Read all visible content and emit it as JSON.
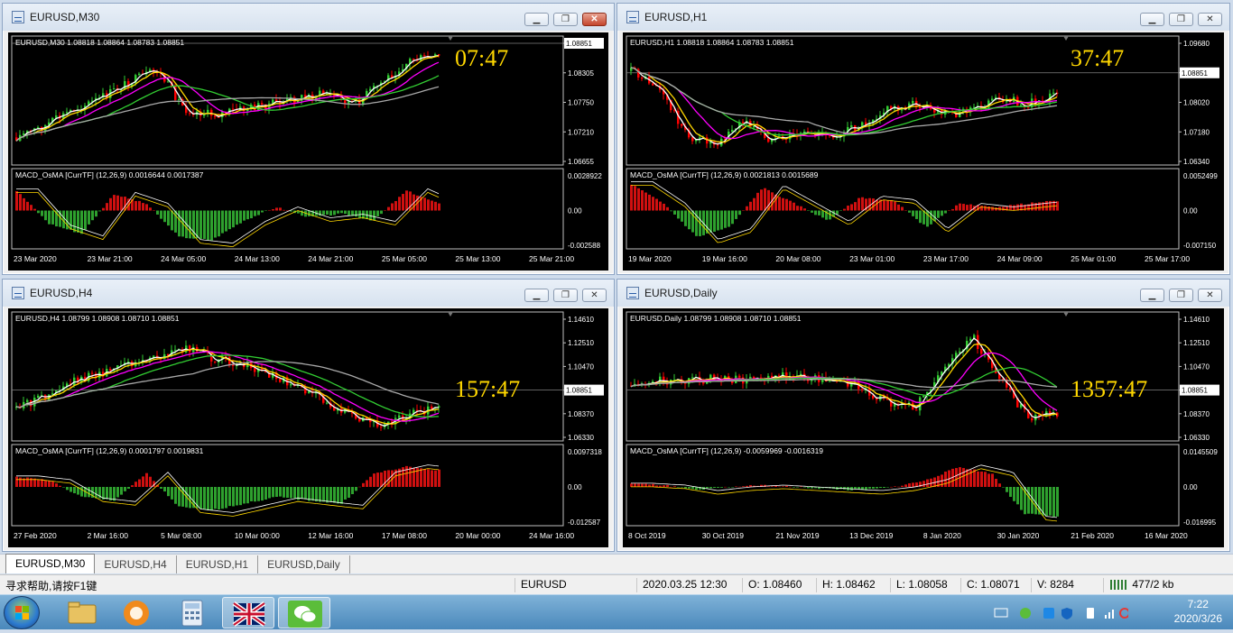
{
  "windows": [
    {
      "title": "EURUSD,M30",
      "info": "EURUSD,M30  1.08818 1.08864 1.08783 1.08851",
      "price_ticks": [
        "1.08851",
        "1.08305",
        "1.07750",
        "1.07210",
        "1.06655"
      ],
      "price_tag": "1.08851",
      "macd_label": "MACD_OsMA [CurrTF] (12,26,9) 0.0016644 0.0017387",
      "macd_ticks": [
        "0.0028922",
        "0.00",
        "-0.002588"
      ],
      "time_labels": [
        "23 Mar 2020",
        "23 Mar 21:00",
        "24 Mar 05:00",
        "24 Mar 13:00",
        "24 Mar 21:00",
        "25 Mar 05:00",
        "25 Mar 13:00",
        "25 Mar 21:00"
      ],
      "countdown": "07:47"
    },
    {
      "title": "EURUSD,H1",
      "info": "EURUSD,H1  1.08818 1.08864 1.08783 1.08851",
      "price_ticks": [
        "1.09680",
        "1.08851",
        "1.08020",
        "1.07180",
        "1.06340"
      ],
      "price_tag": "1.08851",
      "macd_label": "MACD_OsMA [CurrTF] (12,26,9) 0.0021813 0.0015689",
      "macd_ticks": [
        "0.0052499",
        "0.00",
        "-0.007150"
      ],
      "time_labels": [
        "19 Mar 2020",
        "19 Mar 16:00",
        "20 Mar 08:00",
        "23 Mar 01:00",
        "23 Mar 17:00",
        "24 Mar 09:00",
        "25 Mar 01:00",
        "25 Mar 17:00"
      ],
      "countdown": "37:47"
    },
    {
      "title": "EURUSD,H4",
      "info": "EURUSD,H4  1.08799 1.08908 1.08710 1.08851",
      "price_ticks": [
        "1.14610",
        "1.12510",
        "1.10470",
        "1.08851",
        "1.08370",
        "1.06330"
      ],
      "price_tag": "1.08851",
      "macd_label": "MACD_OsMA [CurrTF] (12,26,9) 0.0001797 0.0019831",
      "macd_ticks": [
        "0.0097318",
        "0.00",
        "-0.012587"
      ],
      "time_labels": [
        "27 Feb 2020",
        "2 Mar 16:00",
        "5 Mar 08:00",
        "10 Mar 00:00",
        "12 Mar 16:00",
        "17 Mar 08:00",
        "20 Mar 00:00",
        "24 Mar 16:00"
      ],
      "countdown": "157:47"
    },
    {
      "title": "EURUSD,Daily",
      "info": "EURUSD,Daily  1.08799 1.08908 1.08710 1.08851",
      "price_ticks": [
        "1.14610",
        "1.12510",
        "1.10470",
        "1.08851",
        "1.08370",
        "1.06330"
      ],
      "price_tag": "1.08851",
      "macd_label": "MACD_OsMA [CurrTF] (12,26,9) -0.0059969 -0.0016319",
      "macd_ticks": [
        "0.0145509",
        "0.00",
        "-0.016995"
      ],
      "time_labels": [
        "8 Oct 2019",
        "30 Oct 2019",
        "21 Nov 2019",
        "13 Dec 2019",
        "8 Jan 2020",
        "30 Jan 2020",
        "21 Feb 2020",
        "16 Mar 2020"
      ],
      "countdown": "1357:47"
    }
  ],
  "tabs": [
    "EURUSD,M30",
    "EURUSD,H4",
    "EURUSD,H1",
    "EURUSD,Daily"
  ],
  "status": {
    "help": "寻求帮助,请按F1键",
    "symbol": "EURUSD",
    "datetime": "2020.03.25 12:30",
    "open": "O: 1.08460",
    "high": "H: 1.08462",
    "low": "L: 1.08058",
    "close": "C: 1.08071",
    "volume": "V: 8284",
    "traffic": "477/2 kb"
  },
  "taskbar": {
    "time": "7:22",
    "date": "2020/3/26",
    "apps": [
      "start-orb",
      "file-explorer",
      "browser",
      "calculator",
      "metatrader",
      "wechat"
    ]
  },
  "colors": {
    "candle_up": "#32cd32",
    "candle_down": "#ff0000",
    "ma_fast": "#ffffff",
    "ma_yellow": "#ffd700",
    "ma_magenta": "#ff00ff",
    "ma_green": "#32cd32",
    "ma_gray": "#a9a9a9",
    "countdown": "#ffd700"
  }
}
